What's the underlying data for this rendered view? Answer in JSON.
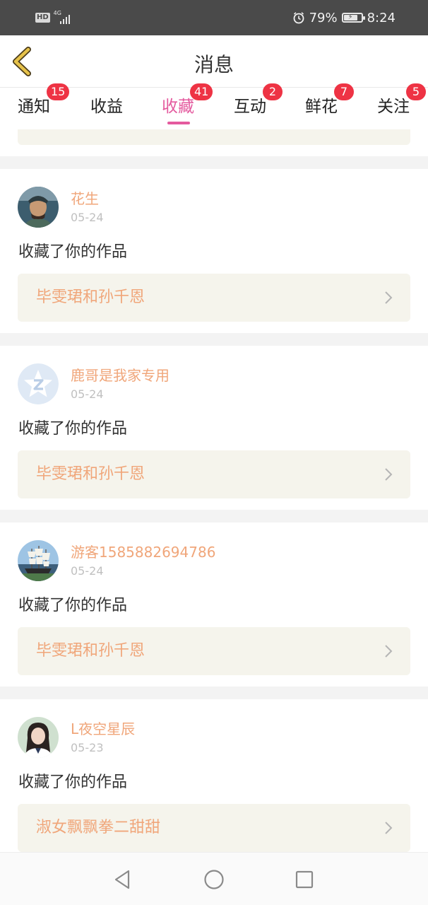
{
  "status_bar": {
    "hd_label": "HD",
    "network_label": "4G",
    "battery_percent": "79%",
    "battery_level": 0.79,
    "time": "8:24"
  },
  "header": {
    "title": "消息",
    "back_icon": "chevron-left-icon",
    "accent_color": "#e6c24a"
  },
  "tabs": [
    {
      "label": "通知",
      "badge": "15"
    },
    {
      "label": "收益",
      "badge": ""
    },
    {
      "label": "收藏",
      "badge": "41",
      "active": true
    },
    {
      "label": "互动",
      "badge": "2"
    },
    {
      "label": "鲜花",
      "badge": "7"
    },
    {
      "label": "关注",
      "badge": "5"
    }
  ],
  "colors": {
    "active_tab": "#e45a9e",
    "badge": "#ee3344",
    "username": "#f0a67a",
    "work_box": "#f5f4ec"
  },
  "messages": [
    {
      "username": "花生",
      "date": "05-24",
      "action": "收藏了你的作品",
      "work_title": "毕雯珺和孙千恩",
      "avatar": "warrior-avatar"
    },
    {
      "username": "鹿哥是我家专用",
      "date": "05-24",
      "action": "收藏了你的作品",
      "work_title": "毕雯珺和孙千恩",
      "avatar": "default-star-avatar"
    },
    {
      "username": "游客1585882694786",
      "date": "05-24",
      "action": "收藏了你的作品",
      "work_title": "毕雯珺和孙千恩",
      "avatar": "ship-avatar"
    },
    {
      "username": "L夜空星辰",
      "date": "05-23",
      "action": "收藏了你的作品",
      "work_title": "淑女飘飘拳二甜甜",
      "avatar": "girl-avatar"
    }
  ],
  "nav_bar": {
    "back": "triangle-back-icon",
    "home": "circle-home-icon",
    "recents": "square-recents-icon"
  }
}
